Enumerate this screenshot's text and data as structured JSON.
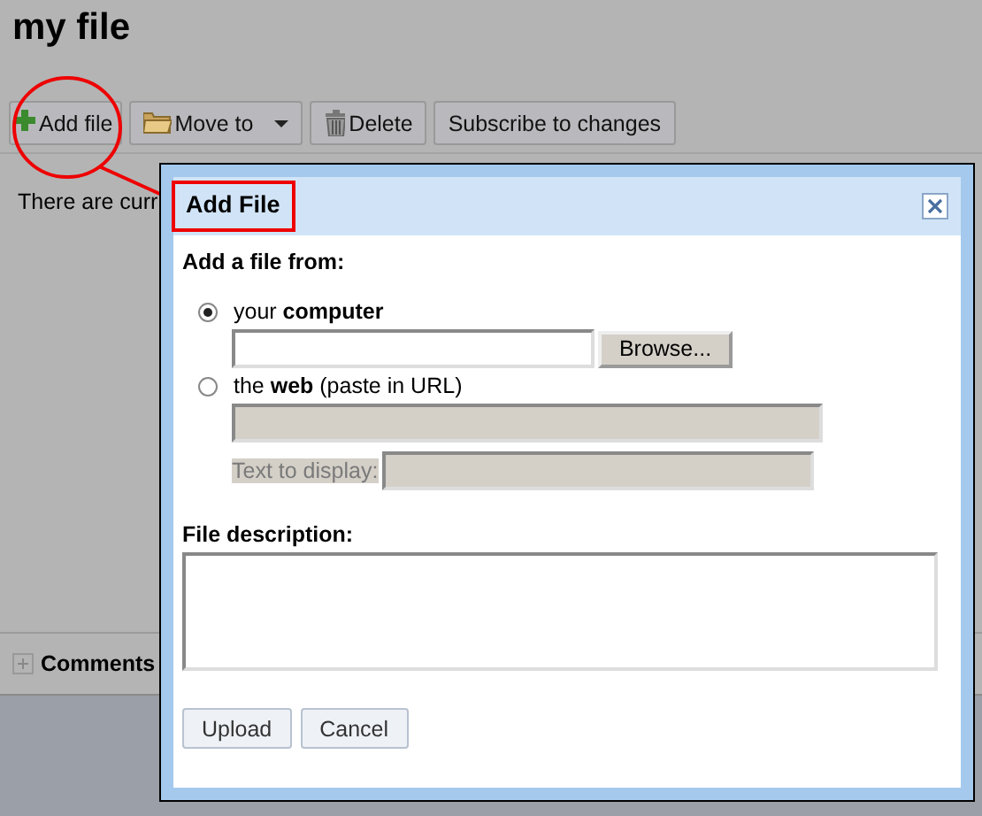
{
  "page": {
    "title": "my file",
    "toolbar": [
      {
        "kind": "plus",
        "label": "Add file",
        "dropdown": false
      },
      {
        "kind": "folder",
        "label": "Move to",
        "dropdown": true
      },
      {
        "kind": "trash",
        "label": "Delete",
        "dropdown": false
      },
      {
        "kind": "none",
        "label": "Subscribe to changes",
        "dropdown": false
      }
    ],
    "message": "There are curr",
    "comments": {
      "label": "Comments",
      "expanded": false
    }
  },
  "dialog": {
    "title": "Add File",
    "intro": "Add a file from:",
    "sources": [
      {
        "label": "your **computer**",
        "selected": true
      },
      {
        "label": "the **web** (paste in URL)",
        "selected": false
      }
    ],
    "browse_button": "Browse...",
    "text_to_display": {
      "label": "Text to display:",
      "disabled": true
    },
    "description_label": "File description:",
    "buttons": [
      "Upload",
      "Cancel"
    ]
  }
}
